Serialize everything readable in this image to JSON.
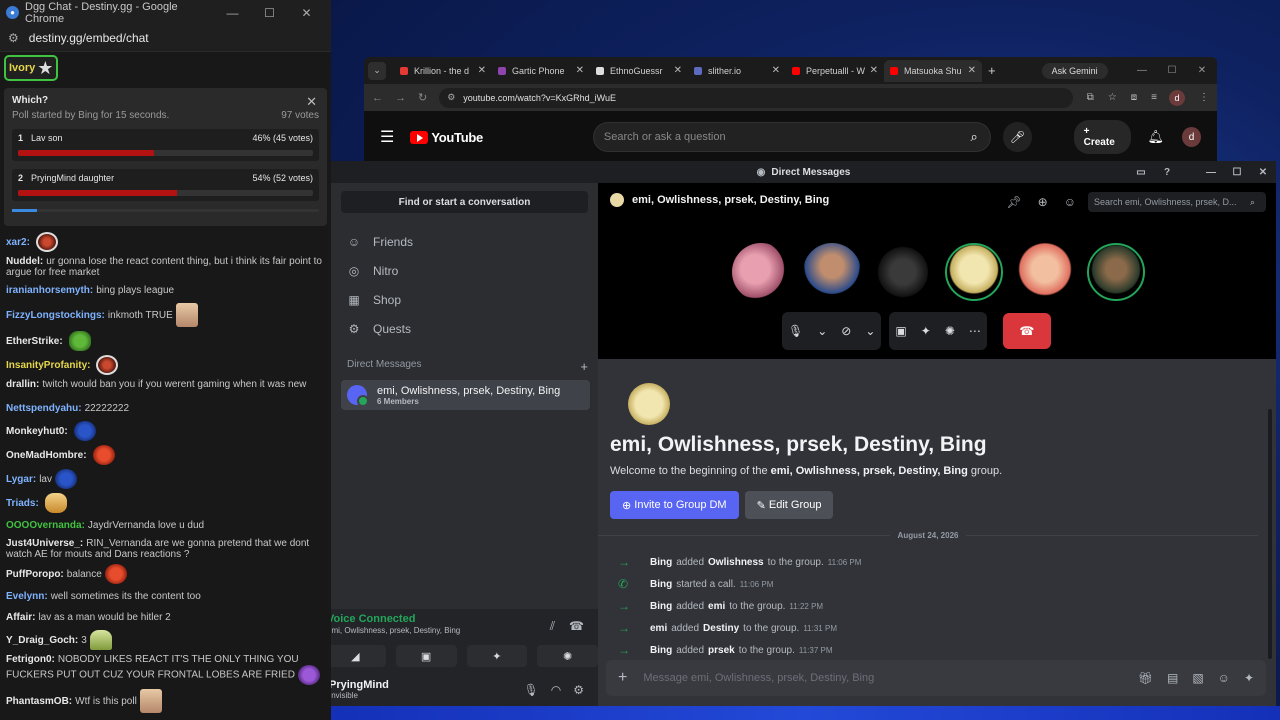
{
  "chat_window": {
    "title": "Dgg Chat - Destiny.gg - Google Chrome",
    "url": "destiny.gg/embed/chat",
    "flair_label": "Ivory",
    "poll": {
      "question": "Which?",
      "started": "Poll started by Bing for 15 seconds.",
      "votes": "97 votes",
      "options": [
        {
          "num": "1",
          "label": "Lav son",
          "result": "46% (45 votes)",
          "pct": 46
        },
        {
          "num": "2",
          "label": "PryingMind daughter",
          "result": "54% (52 votes)",
          "pct": 54
        }
      ]
    },
    "messages": [
      {
        "user": "xar2:",
        "text": "",
        "color": "#7fb3ff",
        "emote": "em-red"
      },
      {
        "user": "Nuddel:",
        "text": "ur gonna lose the react content thing, but i think its fair point to argue for free market",
        "color": "#e8e8e8",
        "emote": ""
      },
      {
        "user": "iranianhorsemyth:",
        "text": "bing plays league",
        "color": "#7fb3ff",
        "emote": ""
      },
      {
        "user": "FizzyLongstockings:",
        "text": "inkmoth TRUE",
        "color": "#7fb3ff",
        "emote": "em-face"
      },
      {
        "user": "EtherStrike:",
        "text": "",
        "color": "#e8e8e8",
        "emote": "em-pepe"
      },
      {
        "user": "InsanityProfanity:",
        "text": "",
        "color": "#e6d64c",
        "emote": "em-red"
      },
      {
        "user": "drallin:",
        "text": "twitch would ban you if you werent gaming when it was new",
        "color": "#e8e8e8",
        "emote": ""
      },
      {
        "user": "Nettspendyahu:",
        "text": "22222222",
        "color": "#7fb3ff",
        "emote": ""
      },
      {
        "user": "Monkeyhut0:",
        "text": "",
        "color": "#e8e8e8",
        "emote": "em-sonic"
      },
      {
        "user": "OneMadHombre:",
        "text": "",
        "color": "#e8e8e8",
        "emote": "em-blob"
      },
      {
        "user": "Lygar:",
        "text": "lav",
        "color": "#7fb3ff",
        "emote": "em-sonic"
      },
      {
        "user": "Triads:",
        "text": "",
        "color": "#7fb3ff",
        "emote": "em-cat"
      },
      {
        "user": "OOOOvernanda:",
        "text": "JaydrVernanda love u dud",
        "color": "#41c241",
        "emote": ""
      },
      {
        "user": "Just4Universe_:",
        "text": "RIN_Vernanda are we gonna pretend that we dont watch AE for mouts and Dans reactions ?",
        "color": "#e8e8e8",
        "emote": ""
      },
      {
        "user": "PuffPoropo:",
        "text": "balance",
        "color": "#e8e8e8",
        "emote": "em-blob"
      },
      {
        "user": "Evelynn:",
        "text": "well sometimes its the content too",
        "color": "#7fb3ff",
        "emote": ""
      },
      {
        "user": "Affair:",
        "text": "lav as a man would be hitler 2",
        "color": "#e8e8e8",
        "emote": ""
      },
      {
        "user": "Y_Draig_Goch:",
        "text": "3",
        "color": "#e8e8e8",
        "emote": "em-tri"
      },
      {
        "user": "Fetrigon0:",
        "text": "NOBODY LIKES REACT IT'S THE ONLY THING YOU FUCKERS PUT OUT CUZ YOUR FRONTAL LOBES ARE FRIED",
        "color": "#e8e8e8",
        "emote": "em-purp"
      },
      {
        "user": "PhantasmOB:",
        "text": "Wtf is this poll",
        "color": "#e8e8e8",
        "emote": "em-face"
      }
    ]
  },
  "chrome": {
    "tabs": [
      {
        "title": "Krillion - the d",
        "color": "#e53935",
        "active": false
      },
      {
        "title": "Gartic Phone",
        "color": "#8e44ad",
        "active": false
      },
      {
        "title": "EthnoGuessr",
        "color": "#dddddd",
        "active": false
      },
      {
        "title": "slither.io",
        "color": "#5c6bc0",
        "active": false
      },
      {
        "title": "Perpetualll - W",
        "color": "#ff0000",
        "active": false
      },
      {
        "title": "Matsuoka Shu",
        "color": "#ff0000",
        "active": true
      }
    ],
    "gemini": "Ask Gemini",
    "url": "youtube.com/watch?v=KxGRhd_iWuE",
    "profile": "d",
    "youtube": {
      "logo": "YouTube",
      "search_placeholder": "Search or ask a question",
      "create": "Create",
      "avatar": "d"
    }
  },
  "discord": {
    "title": "Direct Messages",
    "find": "Find or start a conversation",
    "nav": [
      "Friends",
      "Nitro",
      "Shop",
      "Quests"
    ],
    "dm_header": "Direct Messages",
    "dm_item": {
      "name": "emi, Owlishness, prsek, Destiny, Bing",
      "members": "6 Members"
    },
    "voice": {
      "status": "Voice Connected",
      "channel": "emi, Owlishness, prsek, Destiny, Bing"
    },
    "user": {
      "name": "PryingMind",
      "status": "Invisible"
    },
    "channel_name": "emi, Owlishness, prsek, Destiny, Bing",
    "search_placeholder": "Search emi, Owlishness, prsek, D...",
    "welcome_title": "emi, Owlishness, prsek, Destiny, Bing",
    "welcome_pre": "Welcome to the beginning of the ",
    "welcome_bold": "emi, Owlishness, prsek, Destiny, Bing",
    "welcome_post": " group.",
    "invite_label": "Invite to Group DM",
    "edit_label": "Edit Group",
    "date": "August 24, 2026",
    "events": [
      {
        "type": "arrow",
        "actor": "Bing",
        "verb": "added",
        "target": "Owlishness",
        "suffix": "to the group.",
        "time": "11:06 PM"
      },
      {
        "type": "call",
        "actor": "Bing",
        "verb": "started a call.",
        "target": "",
        "suffix": "",
        "time": "11:06 PM"
      },
      {
        "type": "arrow",
        "actor": "Bing",
        "verb": "added",
        "target": "emi",
        "suffix": "to the group.",
        "time": "11:22 PM"
      },
      {
        "type": "arrow",
        "actor": "emi",
        "verb": "added",
        "target": "Destiny",
        "suffix": "to the group.",
        "time": "11:31 PM"
      },
      {
        "type": "arrow",
        "actor": "Bing",
        "verb": "added",
        "target": "prsek",
        "suffix": "to the group.",
        "time": "11:37 PM"
      }
    ],
    "message_placeholder": "Message emi, Owlishness, prsek, Destiny, Bing"
  }
}
